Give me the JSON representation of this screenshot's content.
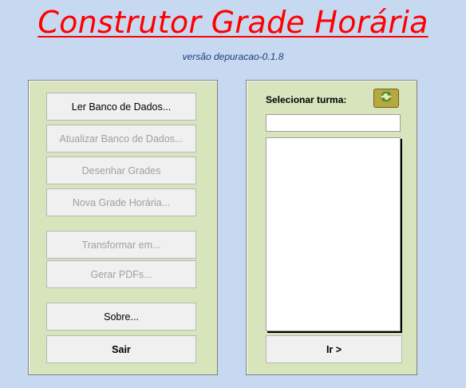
{
  "header": {
    "title": "Construtor Grade Horária",
    "version": "versão depuracao-0.1.8"
  },
  "left_panel": {
    "buttons": [
      {
        "label": "Ler Banco de Dados...",
        "enabled": true
      },
      {
        "label": "Atualizar Banco de Dados...",
        "enabled": false
      },
      {
        "label": "Desenhar Grades",
        "enabled": false
      },
      {
        "label": "Nova Grade Horária...",
        "enabled": false
      },
      {
        "label": "Transformar em...",
        "enabled": false
      },
      {
        "label": "Gerar PDFs...",
        "enabled": false
      },
      {
        "label": "Sobre...",
        "enabled": true
      },
      {
        "label": "Sair",
        "enabled": true
      }
    ]
  },
  "right_panel": {
    "select_label": "Selecionar turma:",
    "refresh_icon": "refresh-icon",
    "turma_value": "",
    "list_items": [],
    "go_label": "Ir >"
  },
  "colors": {
    "background": "#c6d9f1",
    "panel": "#d8e4bc",
    "title": "#ff0000",
    "version": "#1f3d7a",
    "disabled_text": "#a0a0a0"
  }
}
